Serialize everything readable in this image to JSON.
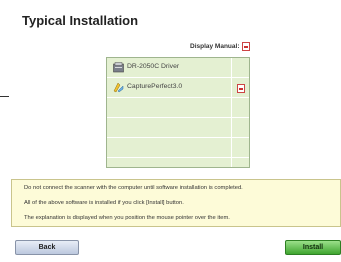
{
  "title": "Typical Installation",
  "manual": {
    "label": "Display Manual:",
    "icon": "pdf-icon"
  },
  "components": [
    {
      "name": "DR-2050C Driver",
      "icon": "scanner-driver-icon",
      "has_manual": false
    },
    {
      "name": "CapturePerfect3.0",
      "icon": "captureperfect-icon",
      "has_manual": true
    }
  ],
  "info": {
    "line1": "Do not connect the scanner with the computer until software installation is completed.",
    "line2": "All of the above software is installed if you click [Install] button.",
    "line3": "The explanation is displayed when you position the mouse pointer over the item."
  },
  "buttons": {
    "back": "Back",
    "install": "Install"
  },
  "colors": {
    "table_bg": "#e4f0d2",
    "info_bg": "#fdfbd8",
    "install_green": "#3fa52f"
  }
}
